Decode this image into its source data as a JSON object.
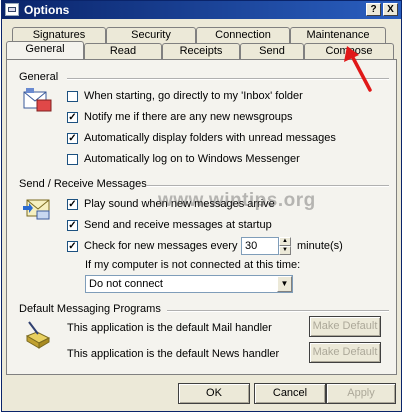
{
  "window": {
    "title": "Options",
    "help_button": "?",
    "close_button": "X"
  },
  "tabs": {
    "back_row": [
      "Signatures",
      "Security",
      "Connection",
      "Maintenance"
    ],
    "front_row": [
      "General",
      "Read",
      "Receipts",
      "Send",
      "Compose"
    ],
    "active": "General"
  },
  "general": {
    "header": "General",
    "options": [
      {
        "label": "When starting, go directly to my 'Inbox' folder",
        "checked": false
      },
      {
        "label": "Notify me if there are any new newsgroups",
        "checked": true
      },
      {
        "label": "Automatically display folders with unread messages",
        "checked": true
      },
      {
        "label": "Automatically log on to Windows Messenger",
        "checked": false
      }
    ]
  },
  "send_receive": {
    "header": "Send / Receive Messages",
    "play_sound": {
      "label": "Play sound when new messages arrive",
      "checked": true
    },
    "send_receive_startup": {
      "label": "Send and receive messages at startup",
      "checked": true
    },
    "check_new": {
      "label": "Check for new messages every",
      "checked": true
    },
    "interval_value": "30",
    "interval_unit": "minute(s)",
    "not_connected_label": "If my computer is not connected at this time:",
    "not_connected_value": "Do not connect"
  },
  "default_programs": {
    "header": "Default Messaging Programs",
    "mail_text": "This application is the default Mail handler",
    "news_text": "This application is the default News handler",
    "make_default_label": "Make Default"
  },
  "footer": {
    "ok": "OK",
    "cancel": "Cancel",
    "apply": "Apply"
  },
  "watermark": "www.wintips.org",
  "check_mark": "✓",
  "colors": {
    "title_bar": "#0a246a",
    "annotation_arrow": "#e01818"
  }
}
